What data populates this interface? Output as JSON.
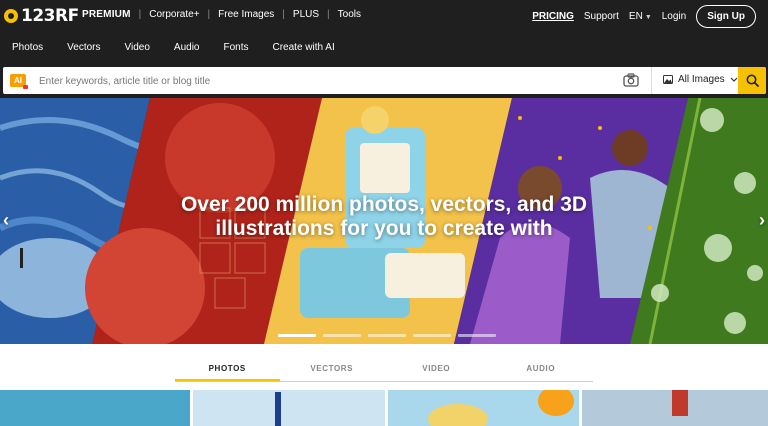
{
  "topbar": {
    "logo_text": "123RF",
    "links": [
      "PREMIUM",
      "Corporate+",
      "Free Images",
      "PLUS",
      "Tools"
    ],
    "pricing": "PRICING",
    "support": "Support",
    "language": "EN",
    "login": "Login",
    "signup": "Sign Up"
  },
  "categories": [
    "Photos",
    "Vectors",
    "Video",
    "Audio",
    "Fonts",
    "Create with AI"
  ],
  "search": {
    "ai_badge": "AI",
    "placeholder": "Enter keywords, article title or blog title",
    "filter": "All Images"
  },
  "hero": {
    "title_line1": "Over 200 million photos, vectors, and 3D",
    "title_line2": "illustrations for you to create with",
    "carousel_count": 5,
    "carousel_active": 0
  },
  "tabs": [
    "PHOTOS",
    "VECTORS",
    "VIDEO",
    "AUDIO"
  ],
  "active_tab": "PHOTOS",
  "colors": {
    "brand_yellow": "#f5c100",
    "nav_bg": "#1f1f1f"
  }
}
